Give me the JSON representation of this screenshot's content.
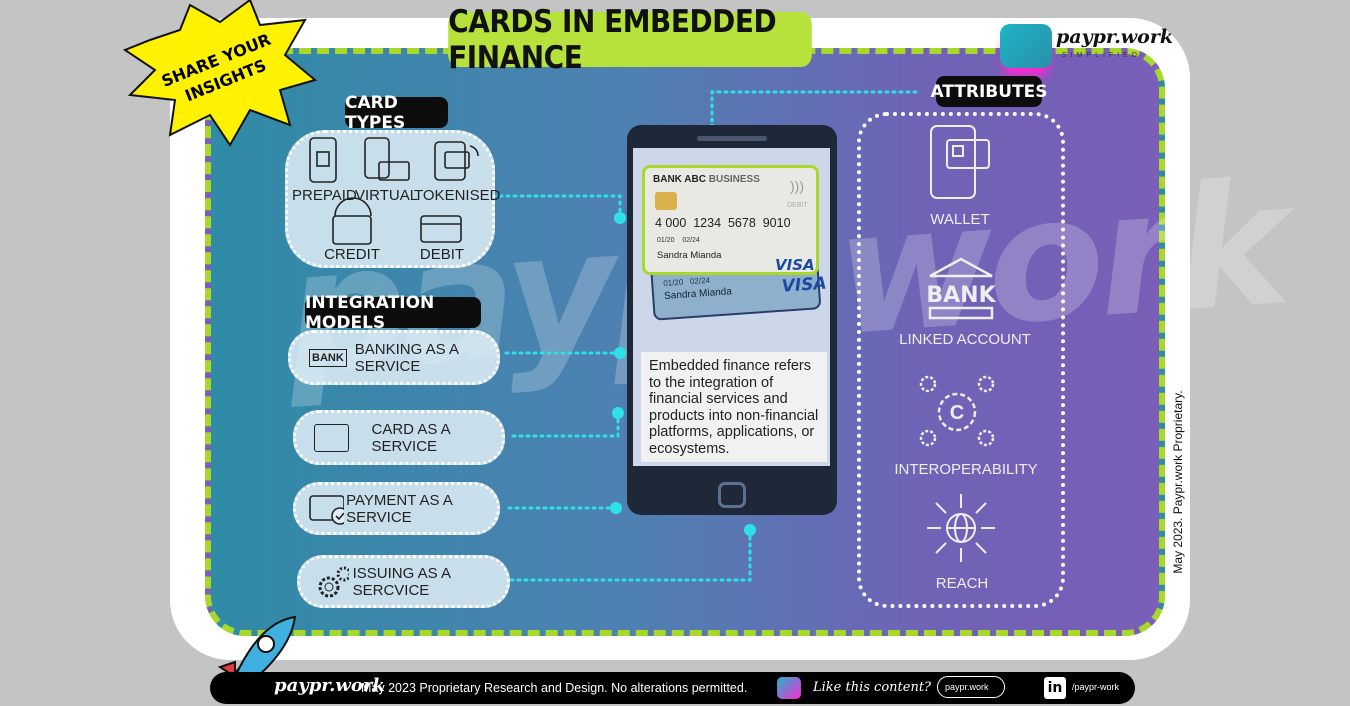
{
  "title": "CARDS IN EMBEDDED FINANCE",
  "burst": {
    "line1": "SHARE YOUR",
    "line2": "INSIGHTS"
  },
  "brand": {
    "name": "paypr.work",
    "tagline": "SIMPLIFIED"
  },
  "watermark": "paypr.work",
  "card_types": {
    "label": "CARD TYPES",
    "items": [
      {
        "label": "PREPAID",
        "icon": "prepaid-phone-icon"
      },
      {
        "label": "VIRTUAL",
        "icon": "virtual-card-icon"
      },
      {
        "label": "TOKENISED",
        "icon": "tokenised-wallet-icon"
      },
      {
        "label": "CREDIT",
        "icon": "credit-card-gauge-icon"
      },
      {
        "label": "DEBIT",
        "icon": "debit-card-icon"
      }
    ]
  },
  "integration_models": {
    "label": "INTEGRATION MODELS",
    "items": [
      {
        "label": "BANKING AS A SERVICE",
        "icon": "bank-icon",
        "icon_text": "BANK"
      },
      {
        "label": "CARD AS A SERVICE",
        "icon": "card-icon"
      },
      {
        "label": "PAYMENT AS A SERVICE",
        "icon": "payment-check-icon"
      },
      {
        "label": "ISSUING AS A SERCVICE",
        "icon": "gears-icon"
      }
    ]
  },
  "phone_card": {
    "bank": "BANK ABC",
    "type": "BUSINESS",
    "debit": "DEBIT",
    "number": "4 000  1234  5678  9010",
    "valid_from": "01/20",
    "valid_to": "02/24",
    "holder": "Sandra Mianda",
    "network": "VISA",
    "back_from": "01/20",
    "back_to": "02/24",
    "back_holder": "Sandra Mianda",
    "back_network": "VISA"
  },
  "description": "Embedded finance refers to the integration of financial services and products into non-financial platforms, applications, or ecosystems.",
  "attributes": {
    "label": "ATTRIBUTES",
    "items": [
      {
        "label": "WALLET",
        "icon": "wallet-phone-icon"
      },
      {
        "label": "LINKED ACCOUNT",
        "icon": "bank-icon",
        "icon_text": "BANK"
      },
      {
        "label": "INTEROPERABILITY",
        "icon": "interoperability-gears-icon"
      },
      {
        "label": "REACH",
        "icon": "globe-arrows-icon"
      }
    ]
  },
  "side_note": "May 2023. Paypr.work Proprietary.",
  "footer": {
    "brand": "paypr.work",
    "notice": "May 2023 Proprietary Research and Design. No alterations permitted.",
    "cta": "Like this content?",
    "web_button": "paypr.work",
    "linkedin": "/paypr-work"
  },
  "colors": {
    "accent_lime": "#b6e23b",
    "connector": "#2ee0e8",
    "gradient_start": "#2f8ba6",
    "gradient_end": "#7a5eb8"
  }
}
